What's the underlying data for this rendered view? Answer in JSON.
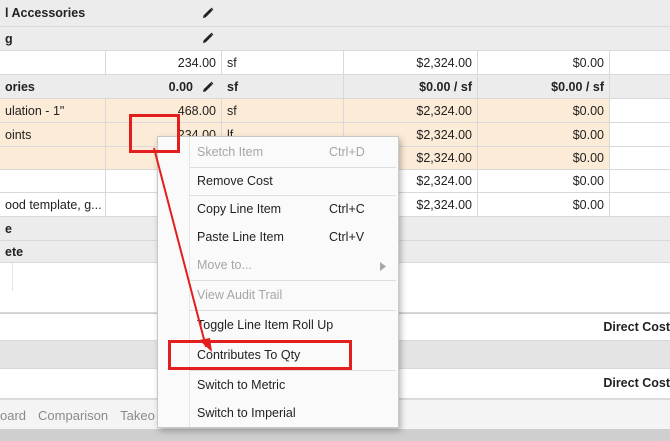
{
  "grid": {
    "group_row_1": {
      "label": "l Accessories"
    },
    "group_row_2": {
      "label": "g"
    },
    "row_1": {
      "qty": "234.00",
      "unit": "sf",
      "cost": "$2,324.00",
      "total": "$0.00"
    },
    "category_row": {
      "label": "ories",
      "qty": "0.00",
      "unit": "sf",
      "cost": "$0.00 / sf",
      "total": "$0.00 / sf"
    },
    "row_insulation": {
      "label": "ulation - 1\"",
      "qty": "468.00",
      "unit": "sf",
      "cost": "$2,324.00",
      "total": "$0.00"
    },
    "row_joints": {
      "label": "oints",
      "qty": "234.00",
      "unit": "lf",
      "cost": "$2,324.00",
      "total": "$0.00"
    },
    "row_5": {
      "cost": "$2,324.00",
      "total": "$0.00"
    },
    "row_6": {
      "cost": "$2,324.00",
      "total": "$0.00"
    },
    "row_template": {
      "label": "ood template, g...",
      "cost": "$2,324.00",
      "total": "$0.00"
    },
    "row_e": {
      "label": "e"
    },
    "row_ete": {
      "label": "ete"
    },
    "summary_1": {
      "label": "Direct Cost"
    },
    "summary_2": {
      "label": "Direct Cost"
    }
  },
  "context_menu": {
    "sketch_item": {
      "label": "Sketch Item",
      "shortcut": "Ctrl+D"
    },
    "remove_cost": {
      "label": "Remove Cost"
    },
    "copy_line_item": {
      "label": "Copy Line Item",
      "shortcut": "Ctrl+C"
    },
    "paste_line_item": {
      "label": "Paste Line Item",
      "shortcut": "Ctrl+V"
    },
    "move_to": {
      "label": "Move to..."
    },
    "view_audit_trail": {
      "label": "View Audit Trail"
    },
    "toggle_roll_up": {
      "label": "Toggle Line Item Roll Up"
    },
    "contributes_to_qty": {
      "label": "Contributes To Qty"
    },
    "switch_metric": {
      "label": "Switch to Metric"
    },
    "switch_imperial": {
      "label": "Switch to Imperial"
    }
  },
  "tabs": {
    "items": [
      "oard",
      "Comparison",
      "Takeo"
    ]
  },
  "colors": {
    "annotation": "#e31e1e",
    "highlight_row": "#fcebd6",
    "group_row": "#ececec"
  }
}
